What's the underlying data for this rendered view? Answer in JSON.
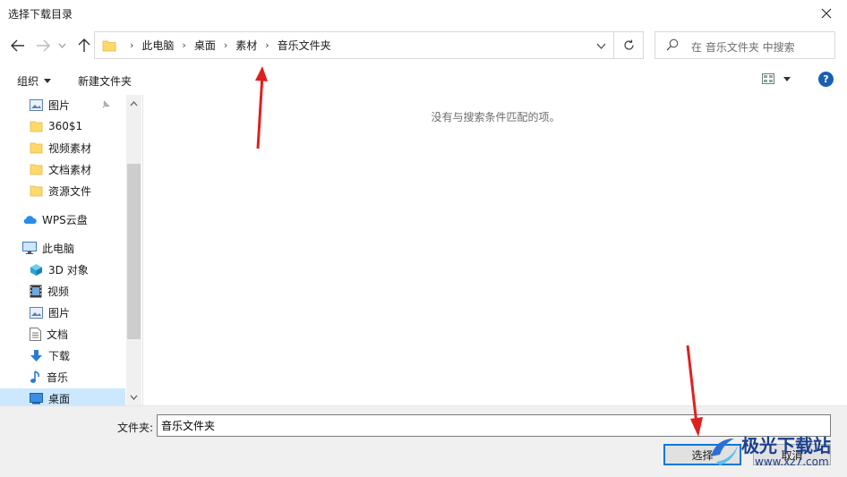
{
  "window": {
    "title": "选择下载目录"
  },
  "nav": {
    "breadcrumbs": [
      "此电脑",
      "桌面",
      "素材",
      "音乐文件夹"
    ],
    "search_placeholder": "在 音乐文件夹 中搜索"
  },
  "toolbar": {
    "organize_label": "组织",
    "new_folder_label": "新建文件夹",
    "help_label": "?"
  },
  "sidebar": {
    "items": [
      {
        "label": "图片",
        "icon": "pictures-icon",
        "pinned": true
      },
      {
        "label": "360$1",
        "icon": "folder-icon"
      },
      {
        "label": "视频素材",
        "icon": "folder-icon"
      },
      {
        "label": "文档素材",
        "icon": "folder-icon"
      },
      {
        "label": "资源文件",
        "icon": "folder-icon"
      },
      {
        "label": "WPS云盘",
        "icon": "cloud-icon"
      },
      {
        "label": "此电脑",
        "icon": "computer-icon"
      },
      {
        "label": "3D 对象",
        "icon": "3d-objects-icon"
      },
      {
        "label": "视频",
        "icon": "video-icon"
      },
      {
        "label": "图片",
        "icon": "pictures-icon"
      },
      {
        "label": "文档",
        "icon": "document-icon"
      },
      {
        "label": "下载",
        "icon": "download-icon"
      },
      {
        "label": "音乐",
        "icon": "music-icon"
      },
      {
        "label": "桌面",
        "icon": "desktop-icon",
        "selected": true
      }
    ]
  },
  "main": {
    "empty_message": "没有与搜索条件匹配的项。"
  },
  "footer": {
    "folder_label": "文件夹:",
    "folder_value": "音乐文件夹",
    "select_label": "选择",
    "cancel_label": "取消"
  },
  "watermark": {
    "brand": "极光下载站",
    "url": "www.xz7.com"
  },
  "colors": {
    "accent": "#0078d7",
    "selection": "#cce8ff",
    "annotation_arrow": "#e02020",
    "folder": "#ffd86b"
  }
}
